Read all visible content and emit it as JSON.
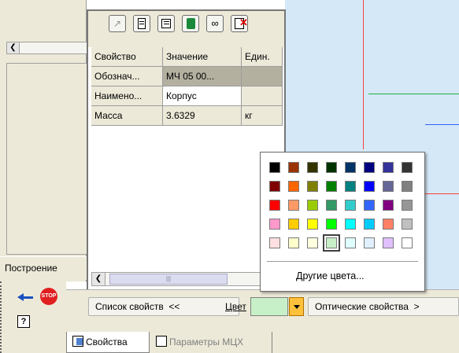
{
  "properties_table": {
    "headers": [
      "Свойство",
      "Значение",
      "Един."
    ],
    "rows": [
      {
        "property": "Обознач...",
        "value": "МЧ 05 00...",
        "unit": ""
      },
      {
        "property": "Наимено...",
        "value": "Корпус",
        "unit": ""
      },
      {
        "property": "Масса",
        "value": "3.6329",
        "unit": "кг"
      }
    ]
  },
  "left_panel": {
    "build_tab_label": "Построение"
  },
  "bottom_toolbar": {
    "property_list_label": "Список свойств  <<",
    "color_label": "Цвет",
    "color_value": "#c8f0c8",
    "optical_label": "Оптические свойства  >"
  },
  "bottom_tabs": {
    "properties": "Свойства",
    "mcx_params": "Параметры МЦХ"
  },
  "color_picker": {
    "more_colors_label": "Другие цвета...",
    "selected_color": "#c8f0c8",
    "rows": [
      [
        "#000000",
        "#993300",
        "#333300",
        "#003300",
        "#003366",
        "#000080",
        "#333399",
        "#333333"
      ],
      [
        "#800000",
        "#ff6600",
        "#808000",
        "#008000",
        "#008080",
        "#0000ff",
        "#666699",
        "#808080"
      ],
      [
        "#ff0000",
        "#ff9966",
        "#99cc00",
        "#339966",
        "#33cccc",
        "#3366ff",
        "#800080",
        "#969696"
      ],
      [
        "#ff99cc",
        "#ffcc00",
        "#ffff00",
        "#00ff00",
        "#00ffff",
        "#00ccff",
        "#ff8066",
        "#c0c0c0"
      ],
      [
        "#ffe0e0",
        "#ffffcc",
        "#ffffe0",
        "#c8f0c8",
        "#e0ffff",
        "#e0f0ff",
        "#e0c0ff",
        "#ffffff"
      ]
    ]
  },
  "icons": {
    "stop": "stop-icon",
    "arrow": "arrow-left-icon",
    "help": "help-icon"
  }
}
